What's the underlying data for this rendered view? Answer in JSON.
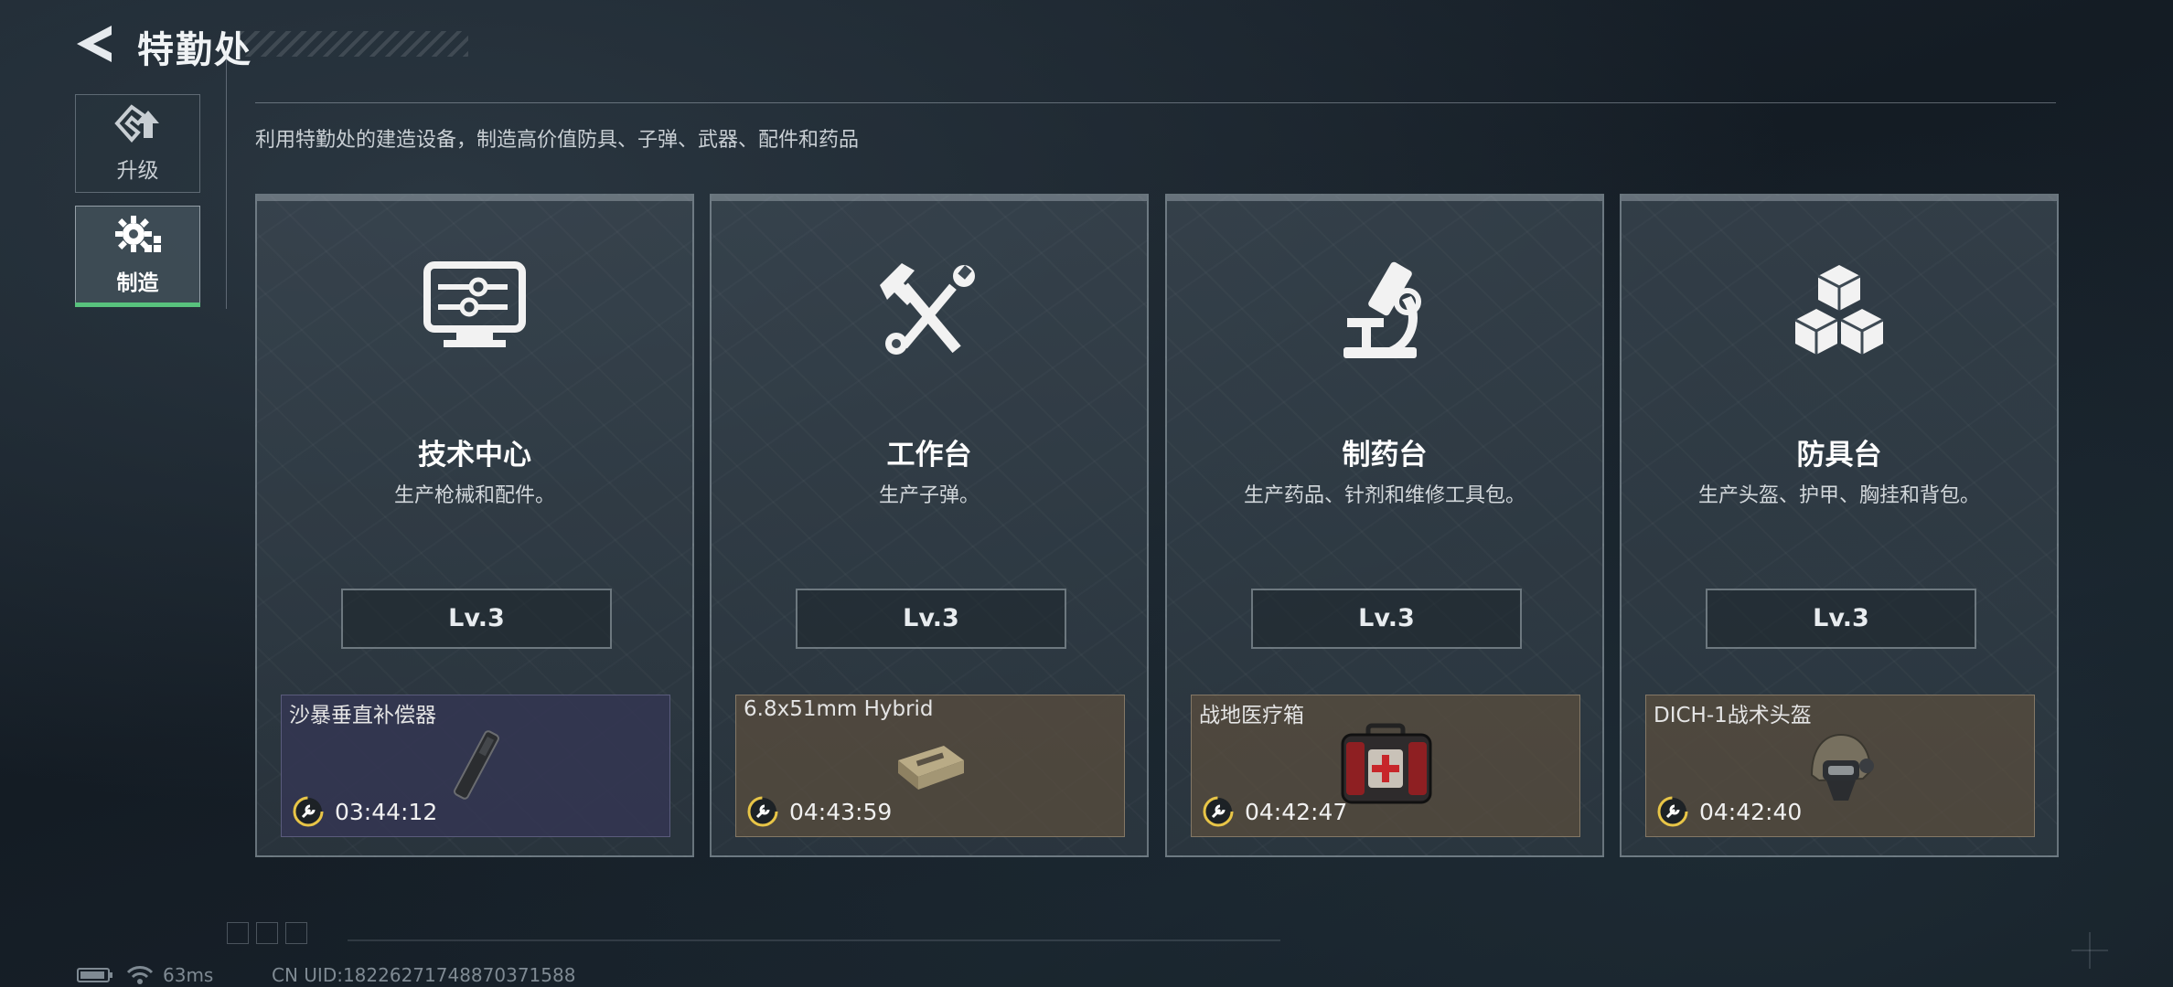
{
  "header": {
    "title": "特勤处"
  },
  "sidebar": {
    "items": [
      {
        "label": "升级",
        "icon": "upgrade-icon",
        "active": false
      },
      {
        "label": "制造",
        "icon": "gear-build-icon",
        "active": true
      }
    ]
  },
  "main": {
    "subtitle": "利用特勤处的建造设备，制造高价值防具、子弹、武器、配件和药品",
    "stations": [
      {
        "name": "技术中心",
        "desc": "生产枪械和配件。",
        "icon": "computer-icon",
        "level": "Lv.3",
        "production": {
          "item": "沙暴垂直补偿器",
          "timer": "03:44:12",
          "rarity_color": "#34365a"
        }
      },
      {
        "name": "工作台",
        "desc": "生产子弹。",
        "icon": "hammer-wrench-icon",
        "level": "Lv.3",
        "production": {
          "item": "6.8x51mm Hybrid",
          "timer": "04:43:59",
          "rarity_color": "#5a4e3e"
        }
      },
      {
        "name": "制药台",
        "desc": "生产药品、针剂和维修工具包。",
        "icon": "microscope-icon",
        "level": "Lv.3",
        "production": {
          "item": "战地医疗箱",
          "timer": "04:42:47",
          "rarity_color": "#5a4e3e"
        }
      },
      {
        "name": "防具台",
        "desc": "生产头盔、护甲、胸挂和背包。",
        "icon": "cubes-icon",
        "level": "Lv.3",
        "production": {
          "item": "DICH-1战术头盔",
          "timer": "04:42:40",
          "rarity_color": "#5a4e3e"
        }
      }
    ]
  },
  "footer": {
    "ping": "63ms",
    "uid": "CN UID:18226271748870371588"
  },
  "colors": {
    "accent_green": "#58c27d",
    "timer_yellow": "#e8c547"
  }
}
